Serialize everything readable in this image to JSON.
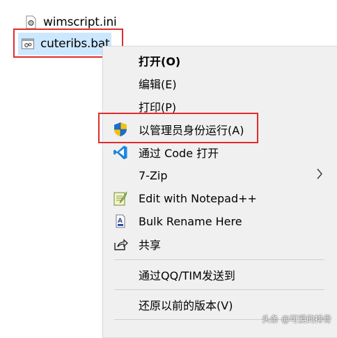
{
  "files": {
    "ini": {
      "name": "wimscript.ini"
    },
    "bat": {
      "name": "cuteribs.bat"
    }
  },
  "context_menu": {
    "open": "打开(O)",
    "edit": "编辑(E)",
    "print": "打印(P)",
    "run_as_admin": "以管理员身份运行(A)",
    "vscode": "通过 Code 打开",
    "sevenzip": "7-Zip",
    "notepadpp": "Edit with Notepad++",
    "bulk_rename": "Bulk Rename Here",
    "share": "共享",
    "send_qq": "通过QQ/TIM发送到",
    "restore": "还原以前的版本(V)"
  },
  "watermark": "头条 @可爱的排骨",
  "icons": {
    "ini": "settings-file-icon",
    "bat": "batch-file-icon",
    "admin": "uac-shield-icon",
    "vscode": "vscode-icon",
    "notepadpp": "notepadpp-icon",
    "bulk_rename": "bulk-rename-icon",
    "share": "share-icon",
    "submenu": "chevron-right-icon"
  },
  "colors": {
    "highlight_box": "#e02b2b",
    "selection": "#cce8ff",
    "menu_bg": "#f0f0f0"
  }
}
